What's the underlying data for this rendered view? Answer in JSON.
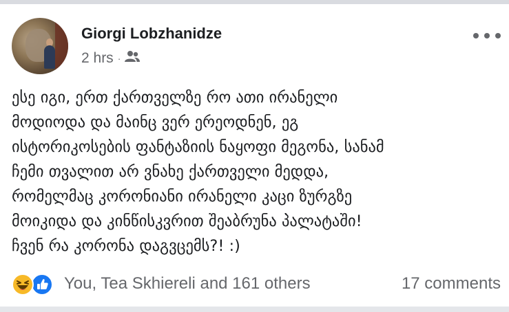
{
  "post": {
    "author": "Giorgi Lobzhanidze",
    "time": "2 hrs",
    "separator": "·",
    "audience_icon": "friends-icon",
    "menu_icon": "more-horizontal-icon",
    "text_lines": [
      "ესე იგი, ერთ ქართველზე რო ათი ირანელი",
      "მოდიოდა და მაინც ვერ ერეოდნენ, ეგ",
      "ისტორიკოსების ფანტაზიის ნაყოფი მეგონა, სანამ",
      "ჩემი თვალით არ ვნახე ქართველი მედდა,",
      "რომელმაც კორონიანი ირანელი კაცი ზურგზე",
      "მოიკიდა და კინწისკვრით შეაბრუნა პალატაში!",
      "ჩვენ რა კორონა დაგვცემს?! :)"
    ]
  },
  "footer": {
    "reaction_icons": [
      "haha-icon",
      "like-icon"
    ],
    "reactors": "You, Tea Skhiereli and 161 others",
    "comments": "17 comments"
  },
  "colors": {
    "text": "#1c1e21",
    "secondary": "#65676b",
    "like_blue": "#1877f2",
    "haha_yellow": "#f7b928"
  }
}
